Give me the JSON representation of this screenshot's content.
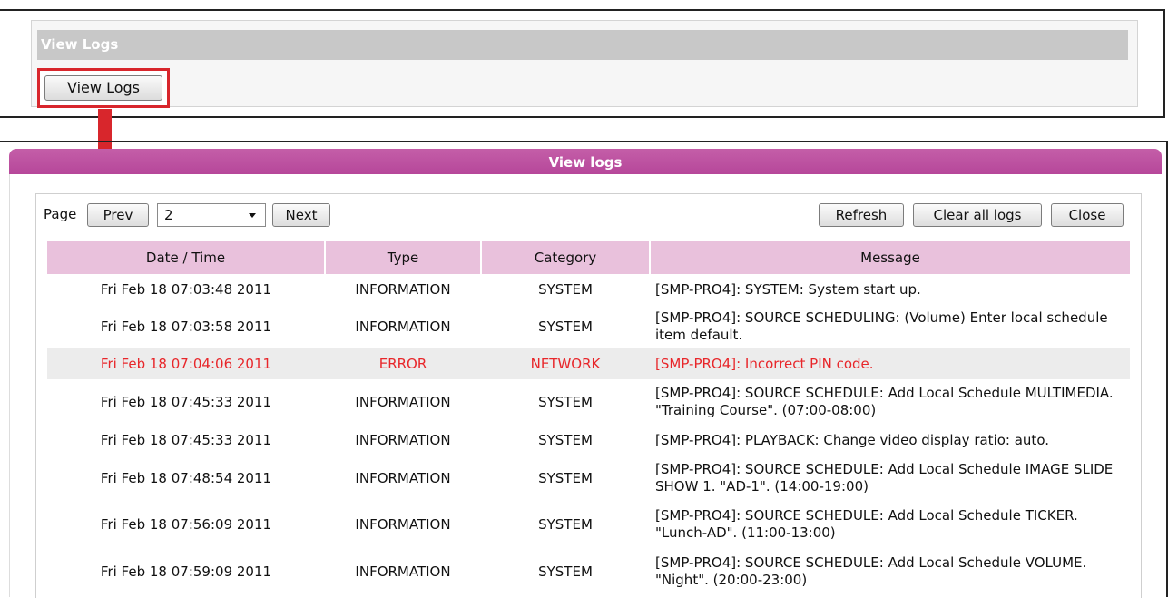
{
  "top_panel": {
    "header": "View Logs",
    "button_label": "View Logs",
    "highlight_color": "#d8262c"
  },
  "window": {
    "title": "View logs",
    "title_color": "#b94f9f",
    "toolbar": {
      "page_label": "Page",
      "prev_label": "Prev",
      "page_select_value": "2",
      "next_label": "Next",
      "refresh_label": "Refresh",
      "clear_label": "Clear all logs",
      "close_label": "Close"
    },
    "table": {
      "columns": [
        "Date / Time",
        "Type",
        "Category",
        "Message"
      ],
      "rows": [
        {
          "datetime": "Fri Feb 18 07:03:48 2011",
          "type": "INFORMATION",
          "category": "SYSTEM",
          "message": "[SMP-PRO4]: SYSTEM: System start up."
        },
        {
          "datetime": "Fri Feb 18 07:03:58 2011",
          "type": "INFORMATION",
          "category": "SYSTEM",
          "message": "[SMP-PRO4]: SOURCE SCHEDULING: (Volume) Enter local schedule item default."
        },
        {
          "datetime": "Fri Feb 18 07:04:06 2011",
          "type": "ERROR",
          "category": "NETWORK",
          "message": "[SMP-PRO4]: Incorrect PIN code."
        },
        {
          "datetime": "Fri Feb 18 07:45:33 2011",
          "type": "INFORMATION",
          "category": "SYSTEM",
          "message": "[SMP-PRO4]: SOURCE SCHEDULE: Add Local Schedule MULTIMEDIA. \"Training Course\". (07:00-08:00)"
        },
        {
          "datetime": "Fri Feb 18 07:45:33 2011",
          "type": "INFORMATION",
          "category": "SYSTEM",
          "message": "[SMP-PRO4]: PLAYBACK: Change video display ratio: auto."
        },
        {
          "datetime": "Fri Feb 18 07:48:54 2011",
          "type": "INFORMATION",
          "category": "SYSTEM",
          "message": "[SMP-PRO4]: SOURCE SCHEDULE: Add Local Schedule IMAGE SLIDE SHOW 1. \"AD-1\". (14:00-19:00)"
        },
        {
          "datetime": "Fri Feb 18 07:56:09 2011",
          "type": "INFORMATION",
          "category": "SYSTEM",
          "message": "[SMP-PRO4]: SOURCE SCHEDULE: Add Local Schedule TICKER. \"Lunch-AD\". (11:00-13:00)"
        },
        {
          "datetime": "Fri Feb 18 07:59:09 2011",
          "type": "INFORMATION",
          "category": "SYSTEM",
          "message": "[SMP-PRO4]: SOURCE SCHEDULE: Add Local Schedule VOLUME. \"Night\". (20:00-23:00)"
        }
      ]
    },
    "error_color": "#e8262a"
  }
}
